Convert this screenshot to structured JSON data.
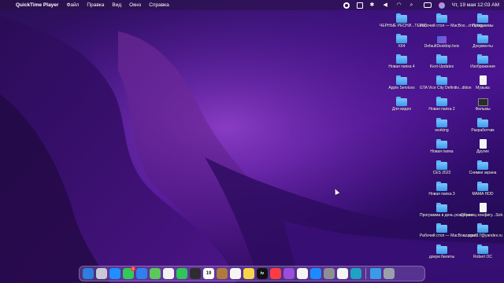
{
  "menubar": {
    "app_name": "QuickTime Player",
    "menus": [
      "Файл",
      "Правка",
      "Вид",
      "Окно",
      "Справка"
    ],
    "clock": "Чт, 19 мая  12:03 AM"
  },
  "desktop": {
    "icons": [
      {
        "label": "ЧЕРНЫЕ РЕСНИ...TEMS)",
        "type": "folder"
      },
      {
        "label": "Рабочий стол — MacBoo...chnology",
        "type": "folder"
      },
      {
        "label": "Программы",
        "type": "folder"
      },
      {
        "label": "X64",
        "type": "folder"
      },
      {
        "label": "DefaultDesktop.heic",
        "type": "image"
      },
      {
        "label": "Документы",
        "type": "folder"
      },
      {
        "label": "Новая папка 4",
        "type": "folder"
      },
      {
        "label": "Kext-Updates",
        "type": "folder"
      },
      {
        "label": "Изображения",
        "type": "folder"
      },
      {
        "label": "Apple Services",
        "type": "folder"
      },
      {
        "label": "GTA Vice City Definitiv...dition",
        "type": "folder"
      },
      {
        "label": "Музыка",
        "type": "doc"
      },
      {
        "label": "Для видео",
        "type": "folder"
      },
      {
        "label": "Новая папка 2",
        "type": "folder"
      },
      {
        "label": "Фильмы",
        "type": "dark"
      },
      {
        "label": "working",
        "type": "folder"
      },
      {
        "label": "Разработчик",
        "type": "folder"
      },
      {
        "label": "Новая папка",
        "type": "folder"
      },
      {
        "label": "Другие",
        "type": "doc"
      },
      {
        "label": "CES 2022",
        "type": "folder"
      },
      {
        "label": "Снимки экрана",
        "type": "folder"
      },
      {
        "label": "Новая папка 3",
        "type": "folder"
      },
      {
        "label": "MAMA HDD",
        "type": "folder"
      },
      {
        "label": "Программа в день рождения",
        "type": "folder"
      },
      {
        "label": "Образец конфигу...Sick VPN",
        "type": "doc"
      },
      {
        "label": "Рабочий стол — MacBoo...дрей",
        "type": "folder"
      },
      {
        "label": "azazaz.17@yandex.ru",
        "type": "folder"
      },
      {
        "label": "докум билеты",
        "type": "folder"
      },
      {
        "label": "Robert OC",
        "type": "folder"
      }
    ]
  },
  "dock": {
    "badge_count": "1",
    "tv_label": "tv",
    "calendar_day": "19",
    "items": [
      {
        "name": "finder",
        "color": "#2f7de1"
      },
      {
        "name": "launchpad",
        "color": "#c9c9d6"
      },
      {
        "name": "safari",
        "color": "#1e90ff"
      },
      {
        "name": "messages",
        "color": "#34c759"
      },
      {
        "name": "mail",
        "color": "#2f80ed"
      },
      {
        "name": "maps",
        "color": "#5ac85a"
      },
      {
        "name": "photos",
        "color": "#f2f2f2"
      },
      {
        "name": "facetime",
        "color": "#30c55a"
      },
      {
        "name": "final-cut",
        "color": "#2d2d2d"
      },
      {
        "name": "calendar",
        "color": "#ffffff"
      },
      {
        "name": "notes-brown",
        "color": "#b07a3c"
      },
      {
        "name": "reminders",
        "color": "#f5f5f5"
      },
      {
        "name": "notes",
        "color": "#f7d54a"
      },
      {
        "name": "apple-tv",
        "color": "#111111"
      },
      {
        "name": "music",
        "color": "#fc3c44"
      },
      {
        "name": "podcasts",
        "color": "#9b4ddb"
      },
      {
        "name": "news",
        "color": "#f4f4f4"
      },
      {
        "name": "app-store",
        "color": "#1a8cff"
      },
      {
        "name": "system-preferences",
        "color": "#8e8e93"
      },
      {
        "name": "chrome",
        "color": "#f4f4f4"
      },
      {
        "name": "edge",
        "color": "#1fa3c5"
      },
      {
        "name": "downloads",
        "color": "#3a9be8"
      },
      {
        "name": "trash",
        "color": "#9aa0aa"
      }
    ]
  }
}
